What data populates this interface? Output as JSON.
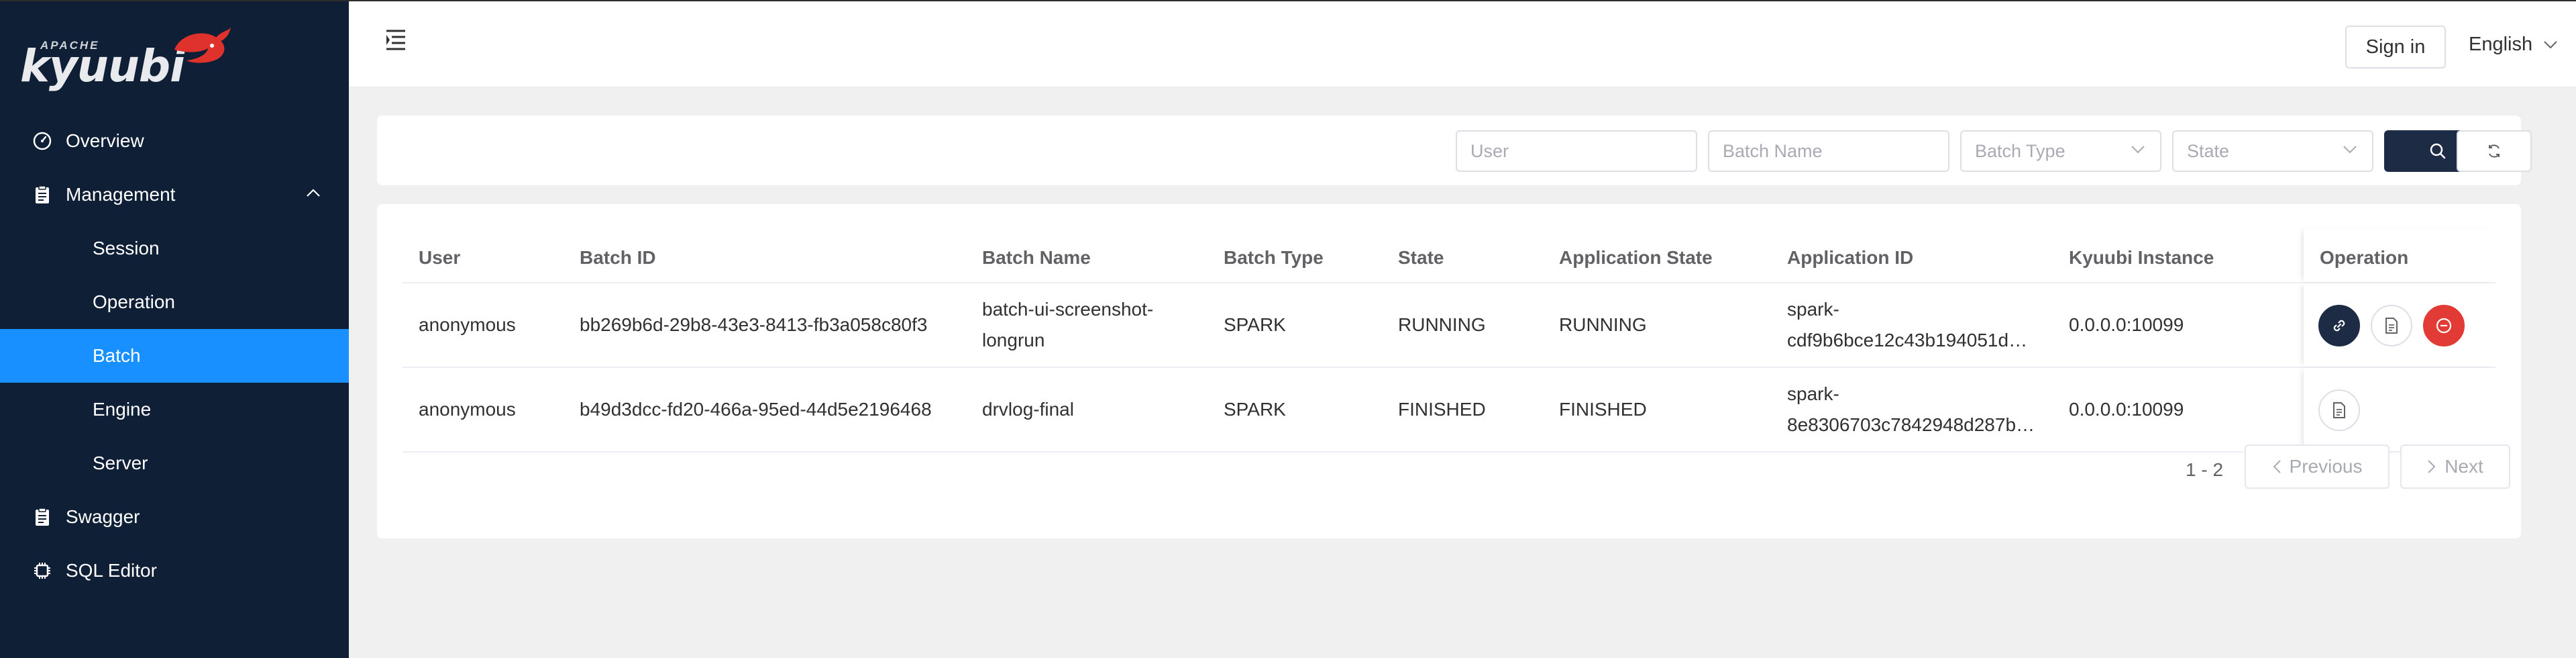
{
  "brand": {
    "top_text": "APACHE",
    "name": "kyuubi"
  },
  "sidebar": {
    "items": [
      {
        "label": "Overview",
        "icon": "speedometer-icon"
      },
      {
        "label": "Management",
        "icon": "clipboard-icon",
        "expanded": true
      },
      {
        "label": "Session",
        "sub": true
      },
      {
        "label": "Operation",
        "sub": true
      },
      {
        "label": "Batch",
        "sub": true,
        "active": true
      },
      {
        "label": "Engine",
        "sub": true
      },
      {
        "label": "Server",
        "sub": true
      },
      {
        "label": "Swagger",
        "icon": "clipboard-icon"
      },
      {
        "label": "SQL Editor",
        "icon": "chip-icon"
      }
    ]
  },
  "header": {
    "sign_in": "Sign in",
    "language": "English"
  },
  "filters": {
    "user_placeholder": "User",
    "batch_name_placeholder": "Batch Name",
    "batch_type_placeholder": "Batch Type",
    "state_placeholder": "State"
  },
  "table": {
    "columns": [
      "User",
      "Batch ID",
      "Batch Name",
      "Batch Type",
      "State",
      "Application State",
      "Application ID",
      "Kyuubi Instance",
      "Operation"
    ],
    "rows": [
      {
        "user": "anonymous",
        "batch_id": "bb269b6d-29b8-43e3-8413-fb3a058c80f3",
        "batch_name_1": "batch-ui-screenshot-",
        "batch_name_2": "longrun",
        "batch_type": "SPARK",
        "state": "RUNNING",
        "app_state": "RUNNING",
        "app_id_1": "spark-",
        "app_id_2": "cdf9b6bce12c43b194051d…",
        "instance": "0.0.0.0:10099",
        "operations": [
          "link-icon",
          "document-icon",
          "stop-icon"
        ]
      },
      {
        "user": "anonymous",
        "batch_id": "b49d3dcc-fd20-466a-95ed-44d5e2196468",
        "batch_name_1": "drvlog-final",
        "batch_name_2": "",
        "batch_type": "SPARK",
        "state": "FINISHED",
        "app_state": "FINISHED",
        "app_id_1": "spark-",
        "app_id_2": "8e8306703c7842948d287b…",
        "instance": "0.0.0.0:10099",
        "operations": [
          "document-icon"
        ]
      }
    ]
  },
  "pagination": {
    "range": "1 - 2",
    "previous": "Previous",
    "next": "Next"
  },
  "colors": {
    "sidebar_bg": "#0f1f35",
    "active": "#1890ff",
    "primary_dark": "#1e2b45",
    "danger": "#e23b35"
  }
}
